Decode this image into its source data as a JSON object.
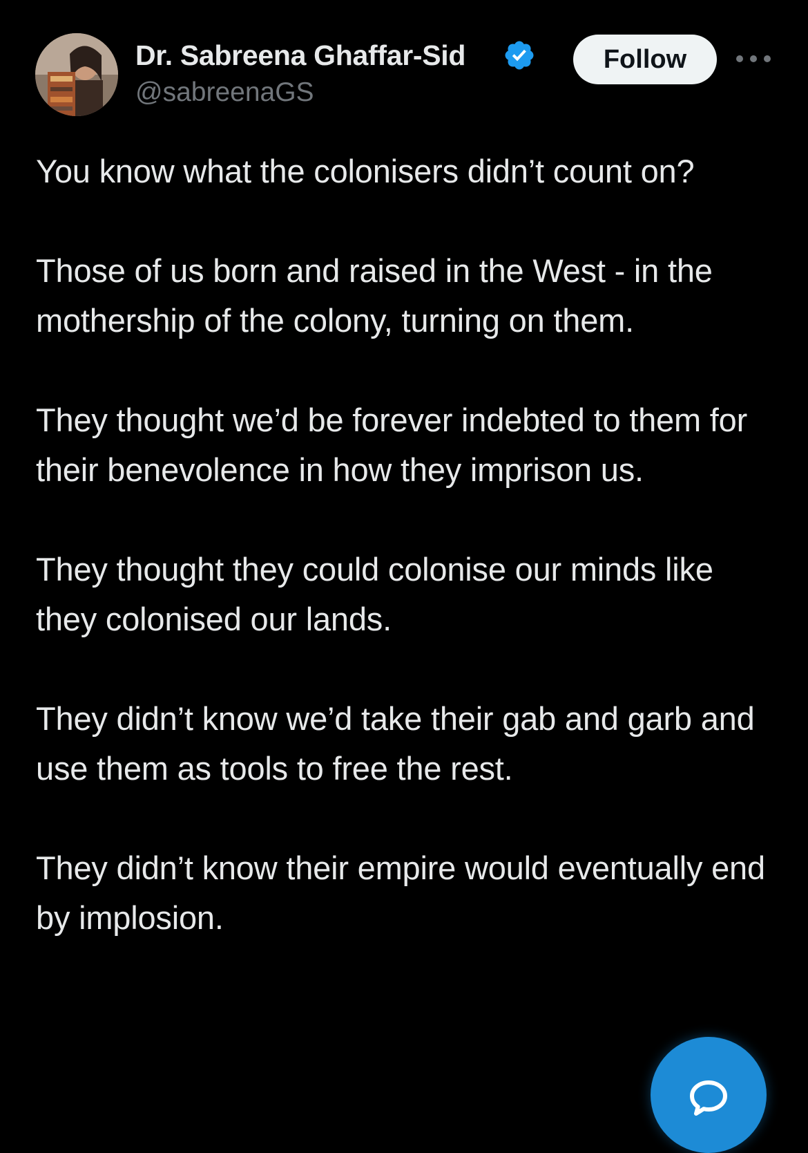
{
  "author": {
    "display_name": "Dr. Sabreena Ghaffar-Sid",
    "handle": "@sabreenaGS",
    "verified_icon": "verified-badge-icon",
    "verified_color": "#1d9bf0"
  },
  "actions": {
    "follow_label": "Follow",
    "more_icon": "more-horizontal-icon",
    "compose_icon": "reply-bubble-icon"
  },
  "tweet": {
    "paragraphs": [
      "You know what the colonisers didn’t count on?",
      "Those of us born and raised in the West - in the mothership of the colony, turning on them.",
      "They thought we’d be forever indebted to them for their benevolence in how they imprison us.",
      "They thought they could colonise our minds like they colonised our lands.",
      "They didn’t know we’d take their gab and garb and use them as tools to free the rest.",
      "They didn’t know their empire would eventually end by implosion."
    ]
  },
  "colors": {
    "background": "#000000",
    "text_primary": "#e7e9ea",
    "text_secondary": "#71767b",
    "accent": "#1d9bf0"
  }
}
